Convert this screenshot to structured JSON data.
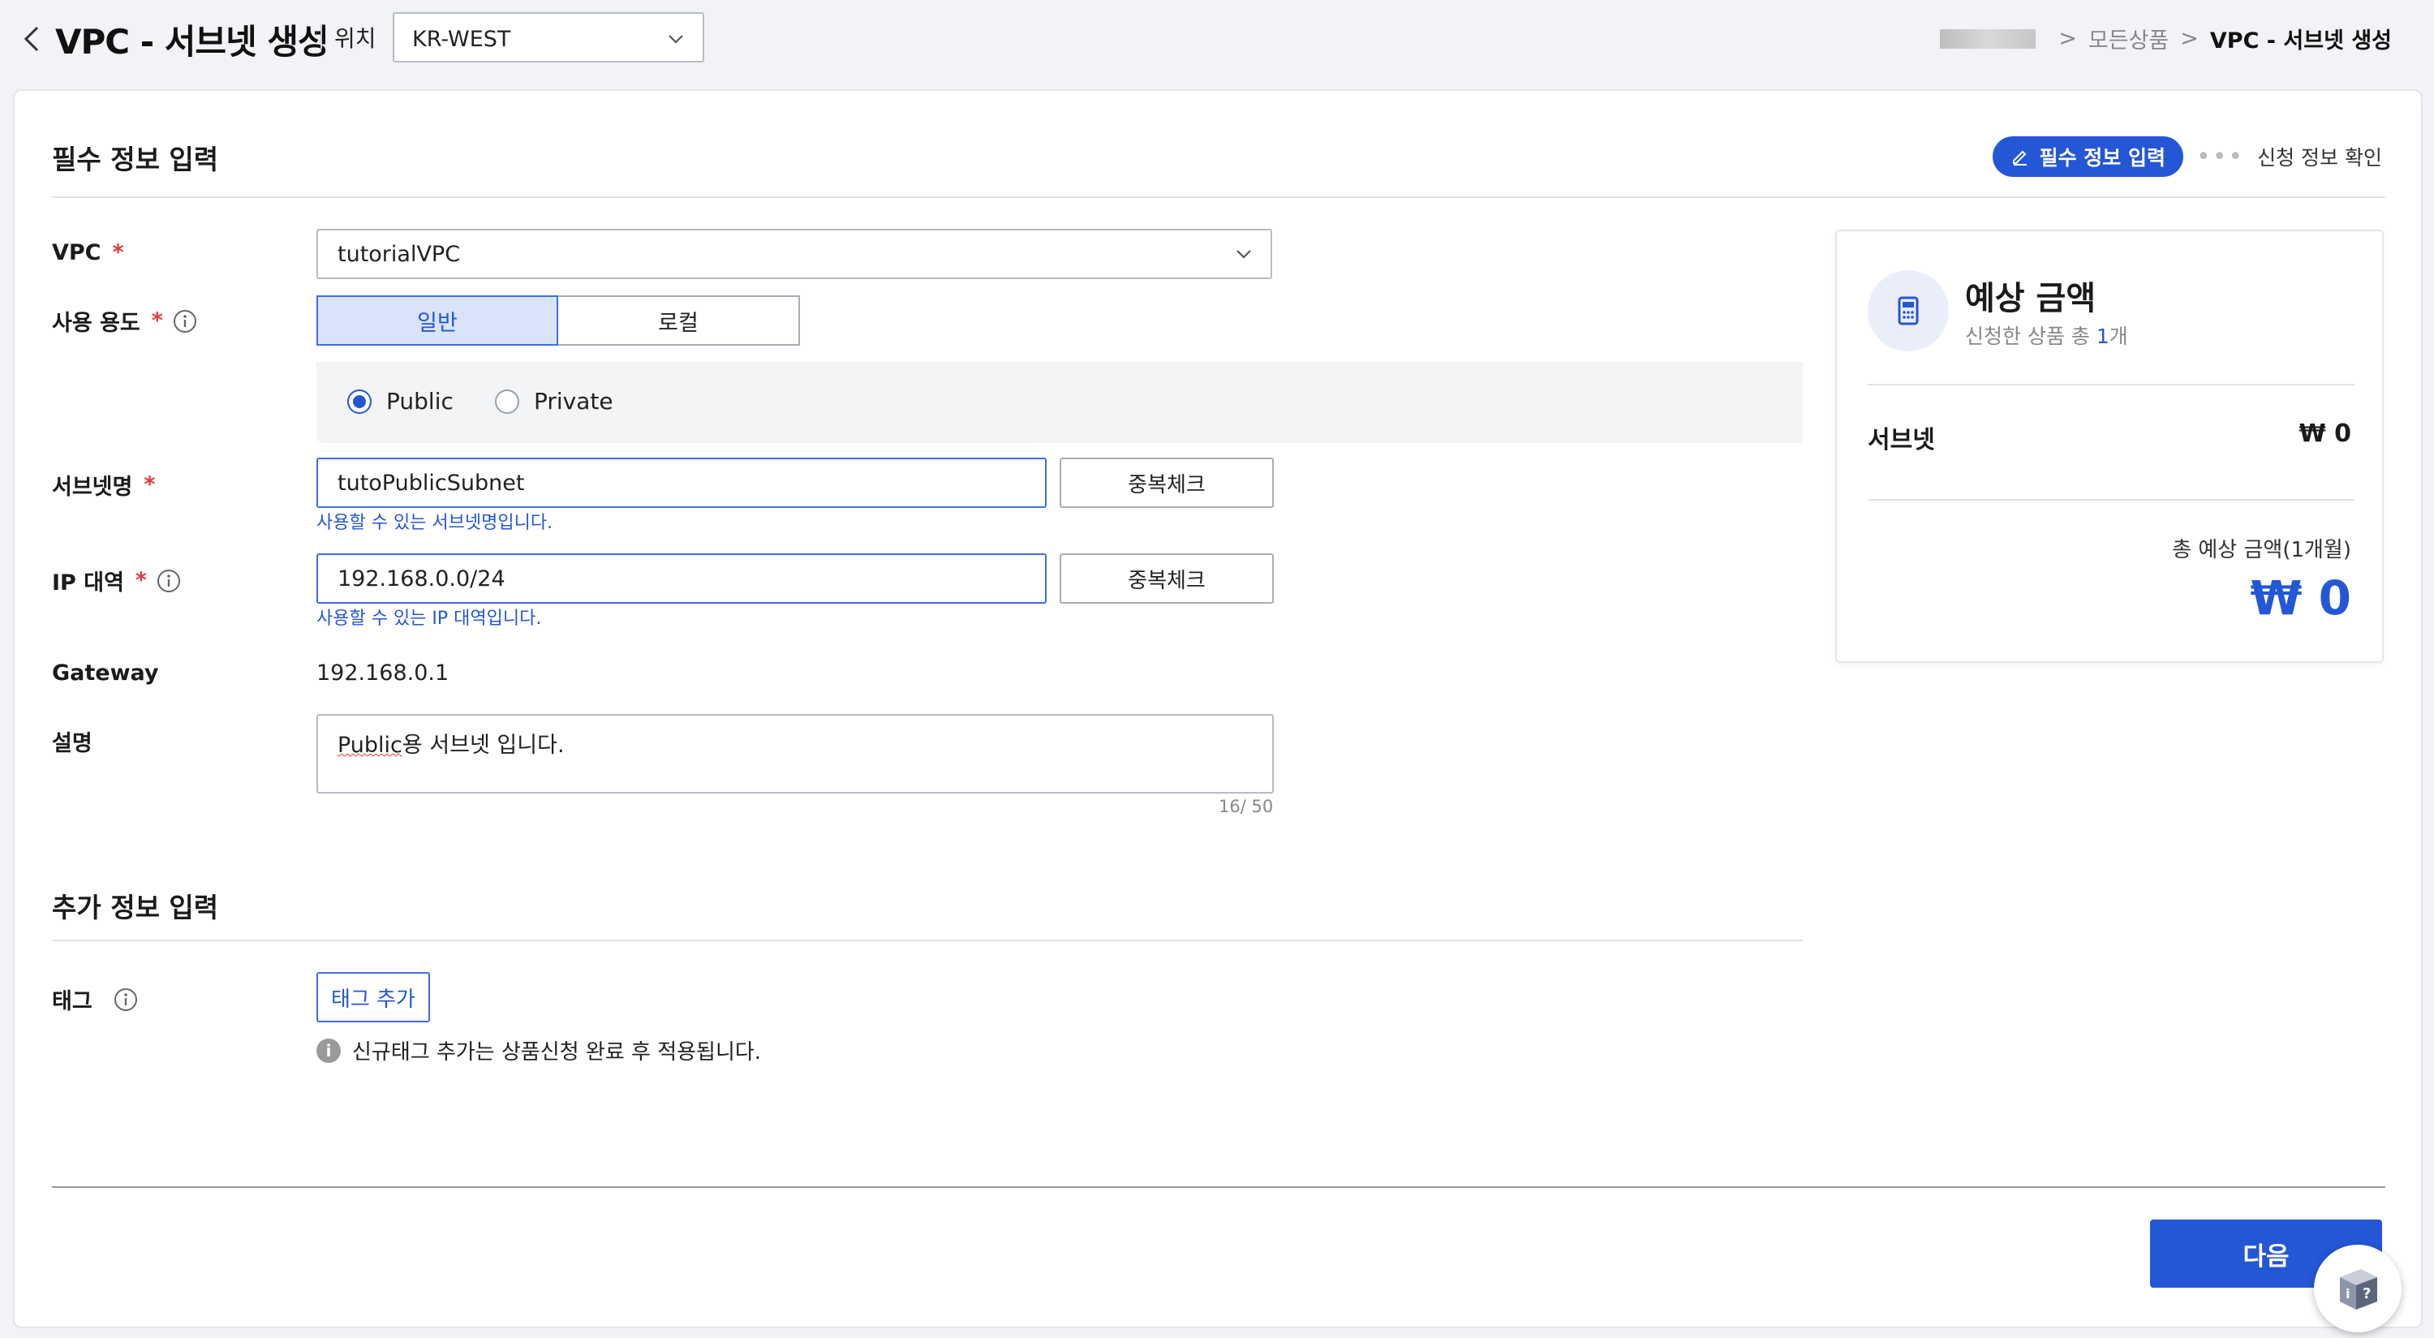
{
  "header": {
    "title": "VPC - 서브넷 생성",
    "location_label": "위치",
    "location_value": "KR-WEST"
  },
  "breadcrumb": {
    "items": [
      "모든상품",
      "VPC - 서브넷 생성"
    ],
    "sep": ">"
  },
  "stepper": {
    "active": "필수 정보 입력",
    "dots": "•••",
    "next": "신청 정보 확인"
  },
  "required_section": {
    "title": "필수 정보 입력",
    "required_mark": "*",
    "vpc": {
      "label": "VPC",
      "value": "tutorialVPC"
    },
    "usage": {
      "label": "사용 용도",
      "options": [
        "일반",
        "로컬"
      ],
      "selected": "일반",
      "radio_options": [
        "Public",
        "Private"
      ],
      "radio_selected": "Public"
    },
    "subnet_name": {
      "label": "서브넷명",
      "value": "tutoPublicSubnet",
      "check_button": "중복체크",
      "hint": "사용할 수 있는 서브넷명입니다."
    },
    "ip_range": {
      "label": "IP 대역",
      "value": "192.168.0.0/24",
      "check_button": "중복체크",
      "hint": "사용할 수 있는 IP 대역입니다."
    },
    "gateway": {
      "label": "Gateway",
      "value": "192.168.0.1"
    },
    "description": {
      "label": "설명",
      "value_underlined": "Public",
      "value_rest": "용 서브넷 입니다.",
      "counter": "16/ 50"
    }
  },
  "additional_section": {
    "title": "추가 정보 입력",
    "tag": {
      "label": "태그",
      "button": "태그 추가",
      "notice": "신규태그 추가는 상품신청 완료 후 적용됩니다."
    }
  },
  "price_card": {
    "title": "예상 금액",
    "sub_prefix": "신청한 상품 총 ",
    "sub_count": "1",
    "sub_suffix": "개",
    "row_label": "서브넷",
    "row_value": "₩ 0",
    "total_label": "총 예상 금액(1개월)",
    "total_value": "₩ 0"
  },
  "footer": {
    "next_button": "다음"
  },
  "colors": {
    "accent": "#2457d6",
    "required": "#e53935",
    "selected_bg": "#d9e3fa"
  },
  "icons": [
    "chevron-left-icon",
    "chevron-down-icon",
    "pencil-icon",
    "info-icon",
    "calculator-icon",
    "help-icon"
  ]
}
